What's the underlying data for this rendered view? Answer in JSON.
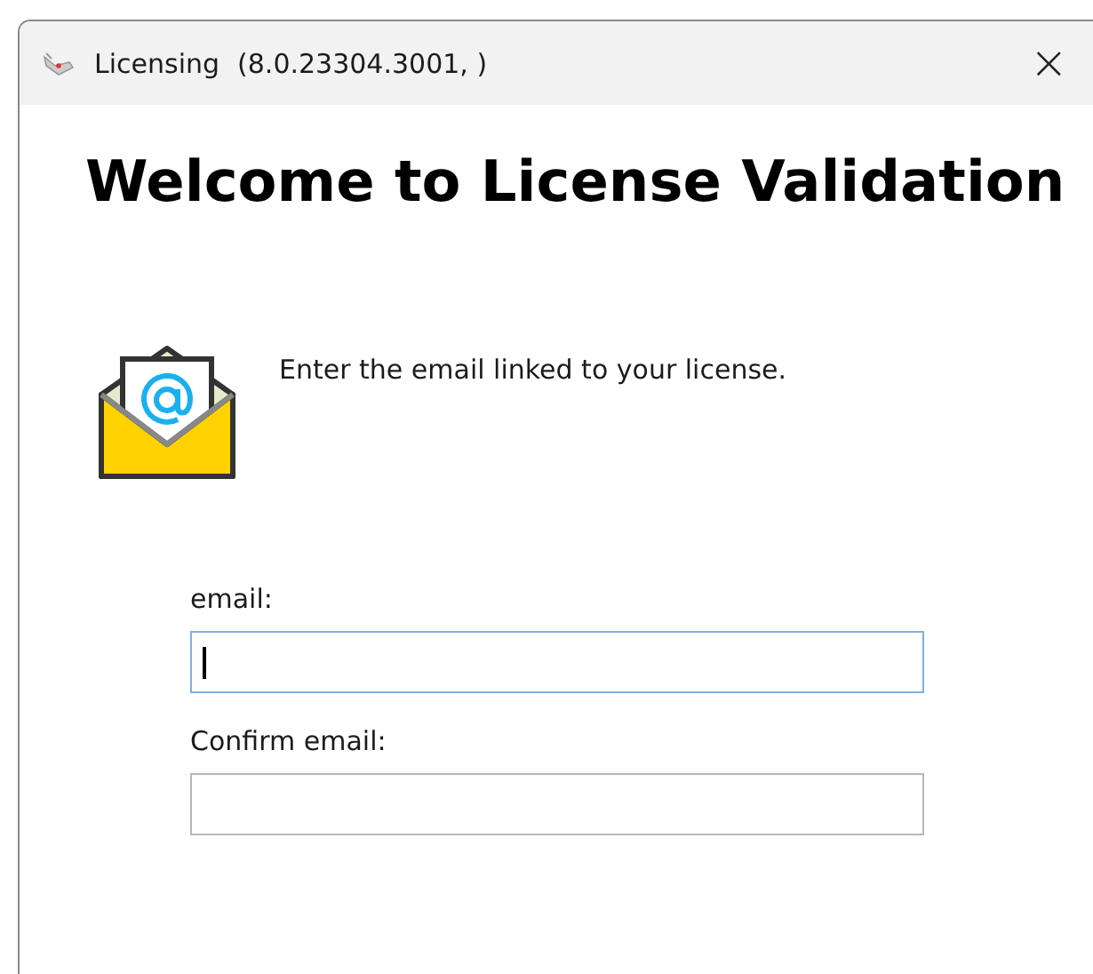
{
  "window": {
    "title": "Licensing",
    "version": "(8.0.23304.3001, )",
    "close": "×"
  },
  "heading": "Welcome to License Validation",
  "instruction": "Enter the email linked to your license.",
  "fields": [
    {
      "label": "email:",
      "focused": true
    },
    {
      "label": "Confirm email:",
      "focused": false
    }
  ]
}
